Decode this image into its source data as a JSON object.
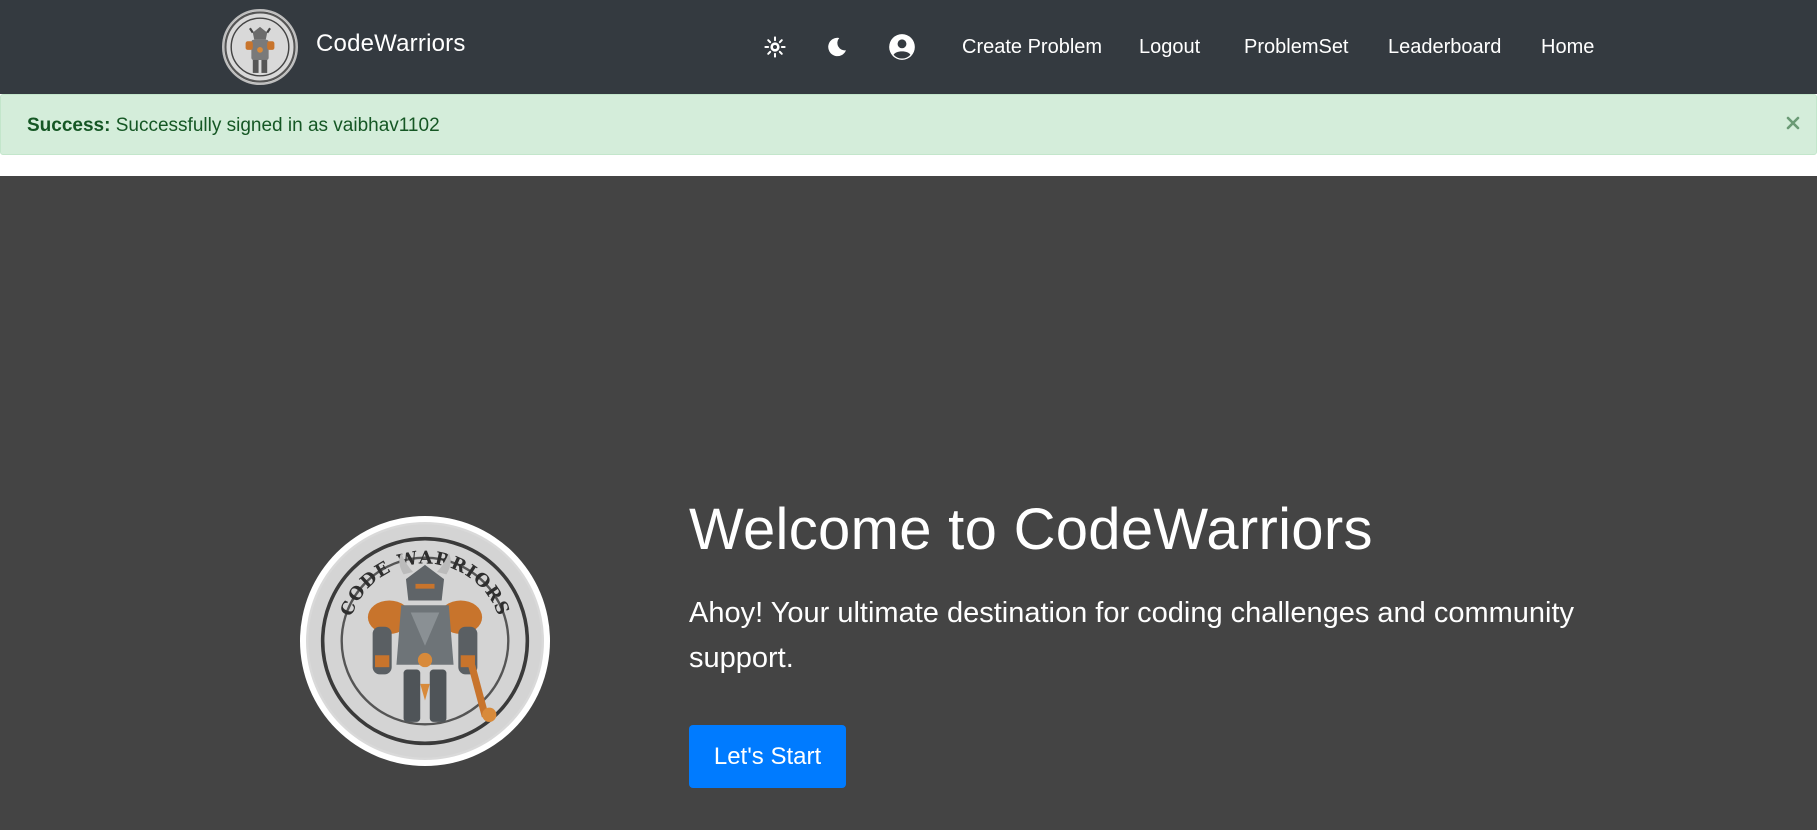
{
  "navbar": {
    "brand": "CodeWarriors",
    "icons": [
      "sun-icon",
      "moon-icon",
      "user-circle-icon"
    ],
    "links": [
      "Create Problem",
      "Logout",
      "ProblemSet",
      "Leaderboard",
      "Home"
    ]
  },
  "alert": {
    "label": "Success:",
    "message": "Successfully signed in as vaibhav1102",
    "close_symbol": "×"
  },
  "hero": {
    "title": "Welcome to CodeWarriors",
    "subtitle": "Ahoy! Your ultimate destination for coding challenges and community support.",
    "button": "Let's Start",
    "logo_text": "CODE WARRIORS"
  },
  "colors": {
    "navbar_bg": "#343a40",
    "alert_bg": "#d4edda",
    "alert_text": "#155724",
    "hero_bg": "#444444",
    "primary": "#007bff"
  }
}
